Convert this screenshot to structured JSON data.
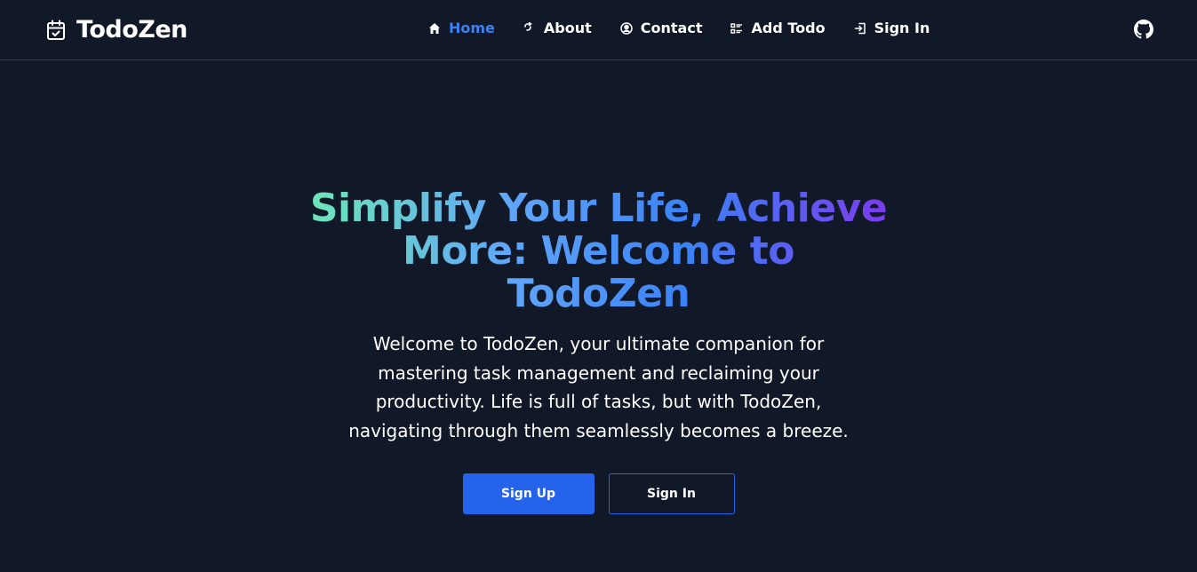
{
  "brand": {
    "name": "TodoZen",
    "icon": "calendar-check-icon"
  },
  "nav": {
    "items": [
      {
        "label": "Home",
        "icon": "home-icon",
        "active": true
      },
      {
        "label": "About",
        "icon": "about-icon",
        "active": false
      },
      {
        "label": "Contact",
        "icon": "contact-icon",
        "active": false
      },
      {
        "label": "Add Todo",
        "icon": "list-icon",
        "active": false
      },
      {
        "label": "Sign In",
        "icon": "sign-in-icon",
        "active": false
      }
    ],
    "github_icon": "github-icon"
  },
  "hero": {
    "headline": "Simplify Your Life, Achieve More: Welcome to TodoZen",
    "lead": "Welcome to TodoZen, your ultimate companion for mastering task management and reclaiming your productivity. Life is full of tasks, but with TodoZen, navigating through them seamlessly becomes a breeze.",
    "primary_button": "Sign Up",
    "secondary_button": "Sign In"
  },
  "colors": {
    "background": "#111827",
    "accent": "#2563eb",
    "active_link": "#3b82f6"
  }
}
